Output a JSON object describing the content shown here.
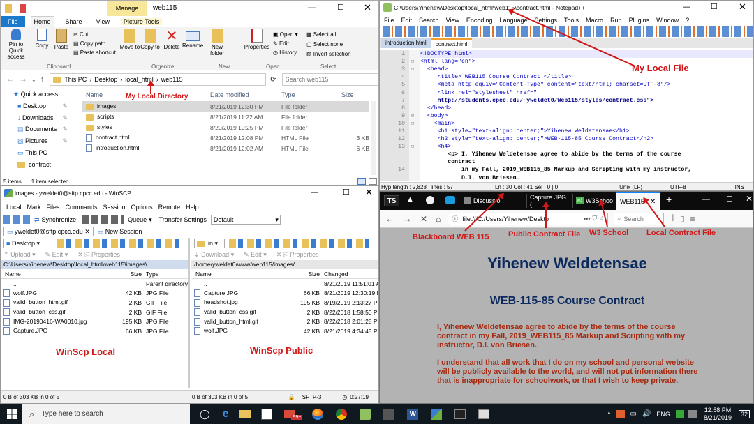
{
  "explorer": {
    "title": "web115",
    "manage_tab": "Manage",
    "tabs": [
      "File",
      "Home",
      "Share",
      "View",
      "Picture Tools"
    ],
    "ribbon": {
      "pin": "Pin to Quick access",
      "copy": "Copy",
      "paste": "Paste",
      "cut": "Cut",
      "copy_path": "Copy path",
      "paste_shortcut": "Paste shortcut",
      "move_to": "Move to",
      "copy_to": "Copy to",
      "delete": "Delete",
      "rename": "Rename",
      "new_folder": "New folder",
      "properties": "Properties",
      "open": "Open",
      "edit": "Edit",
      "history": "History",
      "select_all": "Select all",
      "select_none": "Select none",
      "invert": "Invert selection",
      "groups": [
        "Clipboard",
        "Organize",
        "New",
        "Open",
        "Select"
      ]
    },
    "breadcrumb": [
      "This PC",
      "Desktop",
      "local_html",
      "web115"
    ],
    "search_placeholder": "Search web115",
    "nav": [
      "Quick access",
      "Desktop",
      "Downloads",
      "Documents",
      "Pictures",
      "This PC",
      "contract"
    ],
    "columns": [
      "Name",
      "Date modified",
      "Type",
      "Size"
    ],
    "files": [
      {
        "name": "images",
        "date": "8/21/2019 12:30 PM",
        "type": "File folder",
        "size": "",
        "kind": "folder"
      },
      {
        "name": "scripts",
        "date": "8/21/2019 11:22 AM",
        "type": "File folder",
        "size": "",
        "kind": "folder"
      },
      {
        "name": "styles",
        "date": "8/20/2019 10:25 PM",
        "type": "File folder",
        "size": "",
        "kind": "folder"
      },
      {
        "name": "contract.html",
        "date": "8/21/2019 12:08 PM",
        "type": "HTML File",
        "size": "3 KB",
        "kind": "file"
      },
      {
        "name": "introduction.html",
        "date": "8/21/2019 12:02 AM",
        "type": "HTML File",
        "size": "6 KB",
        "kind": "file"
      }
    ],
    "status": [
      "5 items",
      "1 item selected"
    ]
  },
  "notepad": {
    "title": "C:\\Users\\Yihenew\\Desktop\\local_html\\web115\\contract.html - Notepad++",
    "menu": [
      "File",
      "Edit",
      "Search",
      "View",
      "Encoding",
      "Language",
      "Settings",
      "Tools",
      "Macro",
      "Run",
      "Plugins",
      "Window",
      "?"
    ],
    "tabs": [
      "introduction.html",
      "contract.html"
    ],
    "lines": [
      {
        "n": "1",
        "t": "<!DOCTYPE html>"
      },
      {
        "n": "2",
        "t": "<html lang=\"en\">"
      },
      {
        "n": "3",
        "t": "  <head>"
      },
      {
        "n": "4",
        "t": "     <title> WEB115 Course Contract </title>"
      },
      {
        "n": "5",
        "t": "     <meta http-equiv=\"Content-Type\" content=\"text/html; charset=UTF-8\"/>"
      },
      {
        "n": "6",
        "t": "     <link rel=\"stylesheet\" href=\""
      },
      {
        "n": "7",
        "t": "     http://students.cpcc.edu/~yweldet0/Web115/styles/contract.css\">"
      },
      {
        "n": "8",
        "t": "  </head>"
      },
      {
        "n": "9",
        "t": "  <body>"
      },
      {
        "n": "10",
        "t": "    <main>"
      },
      {
        "n": "11",
        "t": "     <h1 style=\"text-align: center;\">Yihenew Weldetensae</h1>"
      },
      {
        "n": "12",
        "t": "     <h2 style=\"text-align: center;\">WEB-115-85 Course Contract</h2>"
      },
      {
        "n": "13",
        "t": "     <h4>"
      },
      {
        "n": "",
        "t": "        <p> I, Yihenew Weldetensae agree to abide by the terms of the course"
      },
      {
        "n": "",
        "t": "        contract"
      },
      {
        "n": "14",
        "t": "            in my Fall, 2019_WEB115_85 Markup and Scripting with my instructor,"
      },
      {
        "n": "",
        "t": "            D.I. von Briesen."
      }
    ],
    "status": {
      "length": "Hyp length : 2,828",
      "lines": "lines : 57",
      "pos": "Ln : 30    Col : 41    Sel : 0 | 0",
      "eol": "Unix (LF)",
      "enc": "UTF-8",
      "mode": "INS"
    }
  },
  "winscp": {
    "title": "images - yweldet0@sftp.cpcc.edu - WinSCP",
    "menu": [
      "Local",
      "Mark",
      "Files",
      "Commands",
      "Session",
      "Options",
      "Remote",
      "Help"
    ],
    "toolbar": {
      "synchronize": "Synchronize",
      "queue": "Queue",
      "transfer": "Transfer Settings",
      "default": "Default"
    },
    "session": "yweldet0@sftp.cpcc.edu",
    "new_session": "New Session",
    "left_drive": "Desktop",
    "right_drive": "in",
    "left_actions": [
      "Upload",
      "Edit",
      "Properties"
    ],
    "right_actions": [
      "Download",
      "Edit",
      "Properties"
    ],
    "left_path": "C:\\Users\\Yihenew\\Desktop\\local_html\\web115\\images\\",
    "right_path": "/home/yweldet0/www/web115/images/",
    "left_cols": [
      "Name",
      "Size",
      "Type"
    ],
    "right_cols": [
      "Name",
      "Size",
      "Changed"
    ],
    "left_files": [
      {
        "name": "..",
        "size": "",
        "type": "Parent directory"
      },
      {
        "name": "wolf.JPG",
        "size": "42 KB",
        "type": "JPG File"
      },
      {
        "name": "valid_button_html.gif",
        "size": "2 KB",
        "type": "GIF File"
      },
      {
        "name": "valid_button_css.gif",
        "size": "2 KB",
        "type": "GIF File"
      },
      {
        "name": "IMG-20190416-WA0010.jpg",
        "size": "195 KB",
        "type": "JPG File"
      },
      {
        "name": "Capture.JPG",
        "size": "66 KB",
        "type": "JPG File"
      }
    ],
    "right_files": [
      {
        "name": "..",
        "size": "",
        "changed": "8/21/2019 11:51:01 A"
      },
      {
        "name": "Capture.JPG",
        "size": "66 KB",
        "changed": "8/21/2019 12:30:19 P"
      },
      {
        "name": "headshot.jpg",
        "size": "195 KB",
        "changed": "8/19/2019 2:13:27 PM"
      },
      {
        "name": "valid_button_css.gif",
        "size": "2 KB",
        "changed": "8/22/2018 1:58:50 PM"
      },
      {
        "name": "valid_button_html.gif",
        "size": "2 KB",
        "changed": "8/22/2018 2:01:28 PM"
      },
      {
        "name": "wolf.JPG",
        "size": "42 KB",
        "changed": "8/21/2019 4:34:45 PM"
      }
    ],
    "left_status": "0 B of 303 KB in 0 of 5",
    "right_status": "0 B of 303 KB in 0 of 5",
    "sftp": "SFTP-3",
    "time": "0:27:19"
  },
  "firefox": {
    "tabs": [
      "Discussio",
      "Capture.JPG (",
      "W3Schoo",
      "WEB115"
    ],
    "url": "file:///C:/Users/Yihenew/Deskto",
    "search_placeholder": "Search",
    "page_h1": "Yihenew Weldetensae",
    "page_h2": "WEB-115-85 Course Contract",
    "para1": "I, Yihenew Weldetensae agree to abide by the terms of the course contract in my Fall, 2019_WEB115_85 Markup and Scripting with my instructor, D.I. von Briesen.",
    "para2": "I understand that all work that I do on my school and personal website will be publicly available to the world, and will not put information there that is inappropriate for schoolwork, or that I wish to keep private."
  },
  "annotations": {
    "local_dir": "My Local Directory",
    "local_file": "My Local File",
    "winscp_local": "WinScp Local",
    "winscp_public": "WinScp Public",
    "blackboard": "Blackboard WEB 115",
    "public_contract": "Public Contract File",
    "w3": "W3 School",
    "local_contract": "Local Contract File"
  },
  "taskbar": {
    "search": "Type here to search",
    "badge": "99+",
    "lang": "ENG",
    "time": "12:58 PM",
    "date": "8/21/2019",
    "notif": "32"
  }
}
